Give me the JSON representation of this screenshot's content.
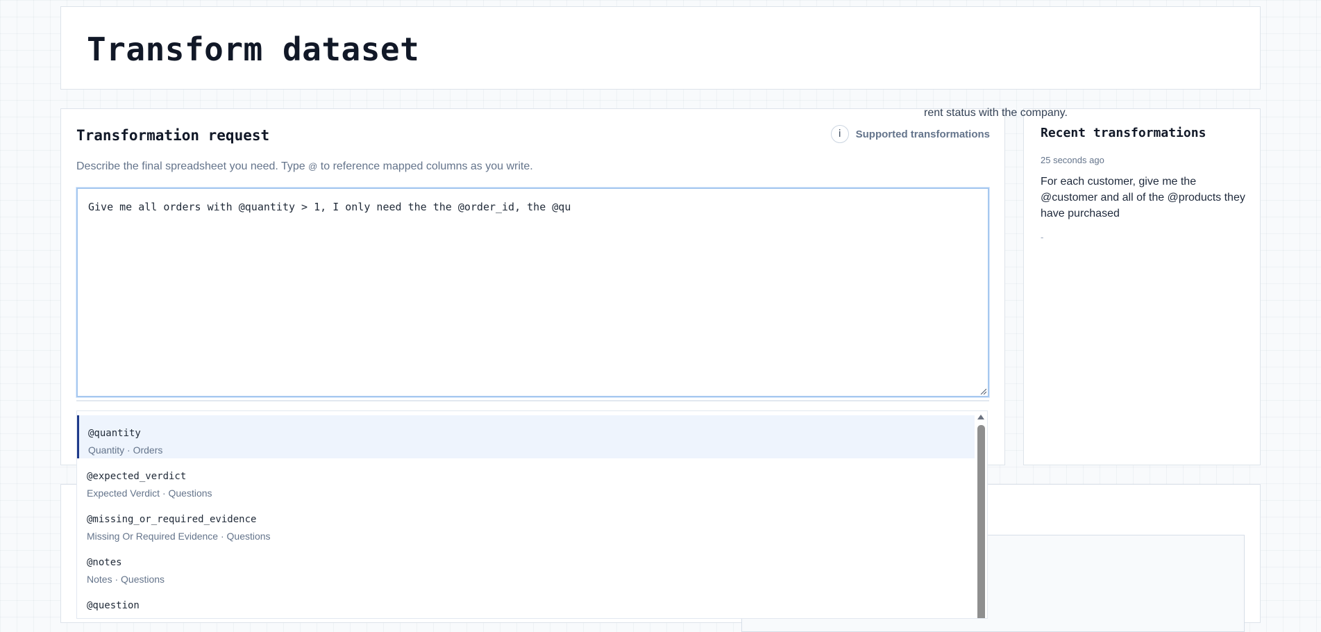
{
  "header": {
    "title": "Transform dataset"
  },
  "request": {
    "title": "Transformation request",
    "info_label": "Supported transformations",
    "info_icon": "i",
    "description_before": "Describe the final spreadsheet you need. Type ",
    "description_at": "@",
    "description_after": " to reference mapped columns as you write.",
    "input_value": "Give me all orders with @quantity > 1, I only need the the @order_id, the @qu"
  },
  "recent": {
    "title": "Recent transformations",
    "items": [
      {
        "time": "25 seconds ago",
        "text": "For each customer, give me the @customer and all of the @products they have purchased",
        "status": "-"
      }
    ]
  },
  "bottom": {
    "partial_text": "rent status with the company."
  },
  "autocomplete": {
    "options": [
      {
        "name": "@quantity",
        "meta": "Quantity · Orders"
      },
      {
        "name": "@expected_verdict",
        "meta": "Expected Verdict · Questions"
      },
      {
        "name": "@missing_or_required_evidence",
        "meta": "Missing Or Required Evidence · Questions"
      },
      {
        "name": "@notes",
        "meta": "Notes · Questions"
      },
      {
        "name": "@question",
        "meta": ""
      }
    ]
  },
  "colors": {
    "accent": "#1e3a8a",
    "focus_border": "#a6c8ef",
    "active_option_bg": "#eef4fd"
  }
}
